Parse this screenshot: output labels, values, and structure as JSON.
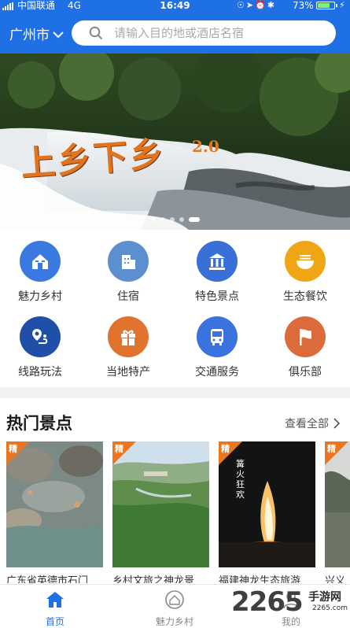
{
  "status_bar": {
    "carrier": "中国联通",
    "network": "4G",
    "time": "16:49",
    "battery": "73%",
    "battery_level": 0.73
  },
  "header": {
    "city": "广州市",
    "search_placeholder": "请输入目的地或酒店名宿"
  },
  "banner": {
    "title": "上乡下乡",
    "subtitle": "2.0",
    "slide_count": 5,
    "active_slide": 5
  },
  "categories": [
    {
      "label": "魅力乡村",
      "icon": "village-icon",
      "color": "#3a7ae0"
    },
    {
      "label": "住宿",
      "icon": "building-icon",
      "color": "#5b8fd0"
    },
    {
      "label": "特色景点",
      "icon": "landmark-icon",
      "color": "#3a6fd8"
    },
    {
      "label": "生态餐饮",
      "icon": "bowl-icon",
      "color": "#f0a614"
    },
    {
      "label": "线路玩法",
      "icon": "route-icon",
      "color": "#1f4fa8"
    },
    {
      "label": "当地特产",
      "icon": "gift-icon",
      "color": "#e0742e"
    },
    {
      "label": "交通服务",
      "icon": "bus-icon",
      "color": "#3a72e0"
    },
    {
      "label": "俱乐部",
      "icon": "flag-icon",
      "color": "#db6b3a"
    }
  ],
  "hot_section": {
    "title": "热门景点",
    "see_all": "查看全部",
    "badge": "精",
    "cards": [
      {
        "name": "广东省英德市石门",
        "overlay": ""
      },
      {
        "name": "乡村文旅之神龙景",
        "overlay": ""
      },
      {
        "name": "福建神龙生态旅游",
        "overlay": "篝火狂欢"
      },
      {
        "name": "兴义",
        "overlay": ""
      }
    ]
  },
  "tabbar": {
    "tabs": [
      {
        "label": "首页",
        "icon": "home-icon",
        "active": true
      },
      {
        "label": "魅力乡村",
        "icon": "village-tab-icon",
        "active": false
      },
      {
        "label": "我的",
        "icon": "user-icon",
        "active": false
      }
    ]
  },
  "watermark": {
    "brand": "2265",
    "sub": "手游网",
    "url": "2265.com"
  },
  "colors": {
    "primary": "#1f6fe5",
    "accent": "#e8771f"
  }
}
